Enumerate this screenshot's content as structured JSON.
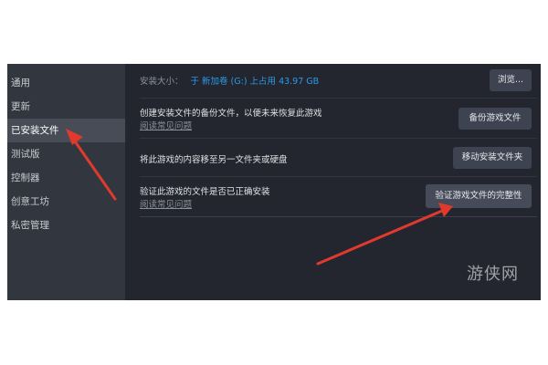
{
  "sidebar": {
    "items": [
      {
        "label": "通用"
      },
      {
        "label": "更新"
      },
      {
        "label": "已安装文件"
      },
      {
        "label": "测试版"
      },
      {
        "label": "控制器"
      },
      {
        "label": "创意工坊"
      },
      {
        "label": "私密管理"
      }
    ],
    "active_index": 2
  },
  "install_size": {
    "label": "安装大小：",
    "value": "于 新加卷 (G:) 上占用 43.97 GB",
    "browse_label": "浏览..."
  },
  "backup": {
    "title": "创建安装文件的备份文件，以便未来恢复此游戏",
    "help_link": "阅读常见问题",
    "button_label": "备份游戏文件"
  },
  "move": {
    "title": "将此游戏的内容移至另一文件夹或硬盘",
    "button_label": "移动安装文件夹"
  },
  "verify": {
    "title": "验证此游戏的文件是否已正确安装",
    "help_link": "阅读常见问题",
    "button_label": "验证游戏文件的完整性"
  },
  "watermark": "游侠网",
  "colors": {
    "sidebar_bg": "#32363e",
    "active_item_bg": "#474c57",
    "main_bg": "#23262e",
    "accent_blue": "#2a9be8",
    "annotation_arrow": "#e03a2e"
  }
}
